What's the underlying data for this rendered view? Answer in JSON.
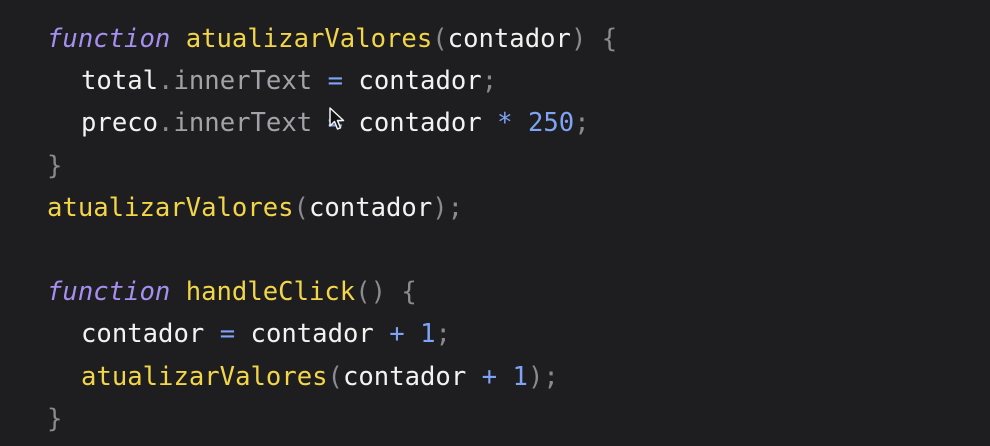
{
  "code": {
    "lines": [
      {
        "tokens": [
          {
            "t": "function",
            "c": "kw"
          },
          {
            "t": " ",
            "c": "plain"
          },
          {
            "t": "atualizarValores",
            "c": "fn"
          },
          {
            "t": "(",
            "c": "punct"
          },
          {
            "t": "contador",
            "c": "plain"
          },
          {
            "t": ") {",
            "c": "punct"
          }
        ]
      },
      {
        "indent": 1,
        "tokens": [
          {
            "t": "total",
            "c": "plain"
          },
          {
            "t": ".",
            "c": "punct"
          },
          {
            "t": "innerText",
            "c": "prop"
          },
          {
            "t": " ",
            "c": "plain"
          },
          {
            "t": "=",
            "c": "op"
          },
          {
            "t": " ",
            "c": "plain"
          },
          {
            "t": "contador",
            "c": "plain"
          },
          {
            "t": ";",
            "c": "punct"
          }
        ]
      },
      {
        "indent": 1,
        "tokens": [
          {
            "t": "preco",
            "c": "plain"
          },
          {
            "t": ".",
            "c": "punct"
          },
          {
            "t": "innerText",
            "c": "prop"
          },
          {
            "t": " ",
            "c": "plain"
          },
          {
            "t": "=",
            "c": "op"
          },
          {
            "t": " ",
            "c": "plain"
          },
          {
            "t": "contador",
            "c": "plain"
          },
          {
            "t": " ",
            "c": "plain"
          },
          {
            "t": "*",
            "c": "op"
          },
          {
            "t": " ",
            "c": "plain"
          },
          {
            "t": "250",
            "c": "num"
          },
          {
            "t": ";",
            "c": "punct"
          }
        ]
      },
      {
        "tokens": [
          {
            "t": "}",
            "c": "punct"
          }
        ]
      },
      {
        "tokens": [
          {
            "t": "atualizarValores",
            "c": "fn"
          },
          {
            "t": "(",
            "c": "punct"
          },
          {
            "t": "contador",
            "c": "plain"
          },
          {
            "t": ");",
            "c": "punct"
          }
        ]
      },
      {
        "tokens": []
      },
      {
        "tokens": [
          {
            "t": "function",
            "c": "kw"
          },
          {
            "t": " ",
            "c": "plain"
          },
          {
            "t": "handleClick",
            "c": "fn"
          },
          {
            "t": "() {",
            "c": "punct"
          }
        ]
      },
      {
        "indent": 1,
        "tokens": [
          {
            "t": "contador",
            "c": "plain"
          },
          {
            "t": " ",
            "c": "plain"
          },
          {
            "t": "=",
            "c": "op"
          },
          {
            "t": " ",
            "c": "plain"
          },
          {
            "t": "contador",
            "c": "plain"
          },
          {
            "t": " ",
            "c": "plain"
          },
          {
            "t": "+",
            "c": "op"
          },
          {
            "t": " ",
            "c": "plain"
          },
          {
            "t": "1",
            "c": "num"
          },
          {
            "t": ";",
            "c": "punct"
          }
        ]
      },
      {
        "indent": 1,
        "tokens": [
          {
            "t": "atualizarValores",
            "c": "fn"
          },
          {
            "t": "(",
            "c": "punct"
          },
          {
            "t": "contador",
            "c": "plain"
          },
          {
            "t": " ",
            "c": "plain"
          },
          {
            "t": "+",
            "c": "op"
          },
          {
            "t": " ",
            "c": "plain"
          },
          {
            "t": "1",
            "c": "num"
          },
          {
            "t": ");",
            "c": "punct"
          }
        ]
      },
      {
        "tokens": [
          {
            "t": "}",
            "c": "punct"
          }
        ]
      }
    ]
  },
  "colors": {
    "background": "#1e1e20",
    "keyword": "#a78ff0",
    "function": "#f3d548",
    "operator": "#7fa3f5",
    "property": "#a2a2a8",
    "punctuation": "#8a8a90",
    "text": "#f2f2f0"
  },
  "cursor_icon": "pointer-arrow-icon"
}
